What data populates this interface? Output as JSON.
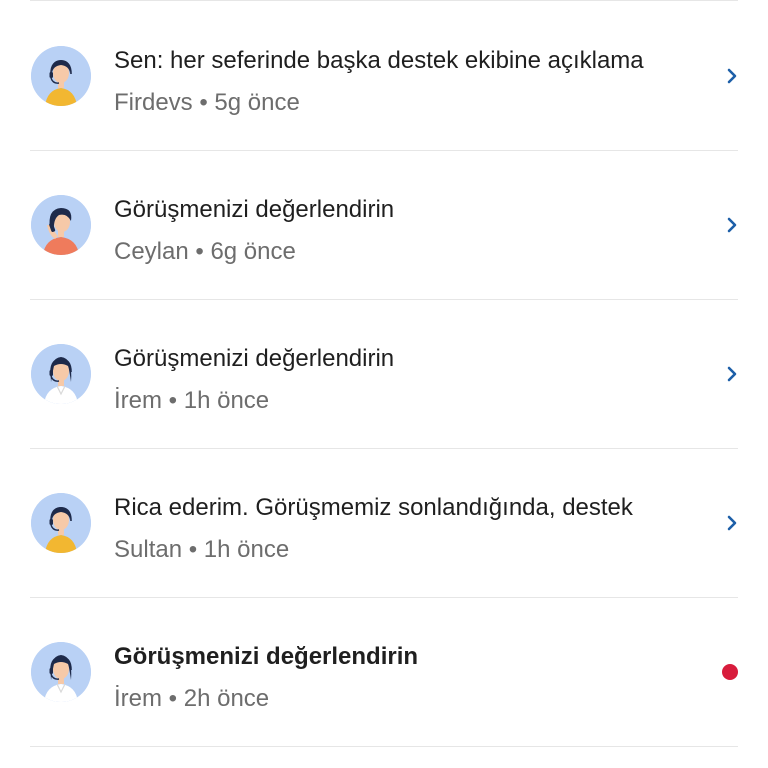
{
  "colors": {
    "accent": "#1d5fa8",
    "unread": "#d81c3c",
    "avatar_bg": "#b9d1f5"
  },
  "conversations": [
    {
      "title": "Sen: her seferinde başka destek ekibine açıklama",
      "subtitle": "Firdevs • 5g önce",
      "agent": "agent-yellow-headset",
      "unread": false,
      "trailing_icon": "chevron-right-icon"
    },
    {
      "title": "Görüşmenizi değerlendirin",
      "subtitle": "Ceylan • 6g önce",
      "agent": "agent-orange-phone",
      "unread": false,
      "trailing_icon": "chevron-right-icon"
    },
    {
      "title": "Görüşmenizi değerlendirin",
      "subtitle": "İrem • 1h önce",
      "agent": "agent-white-headset",
      "unread": false,
      "trailing_icon": "chevron-right-icon"
    },
    {
      "title": "Rica ederim. Görüşmemiz sonlandığında, destek",
      "subtitle": "Sultan • 1h önce",
      "agent": "agent-yellow-headset",
      "unread": false,
      "trailing_icon": "chevron-right-icon"
    },
    {
      "title": "Görüşmenizi değerlendirin",
      "subtitle": "İrem • 2h önce",
      "agent": "agent-white-headset",
      "unread": true,
      "trailing_icon": "unread-dot-icon"
    }
  ]
}
